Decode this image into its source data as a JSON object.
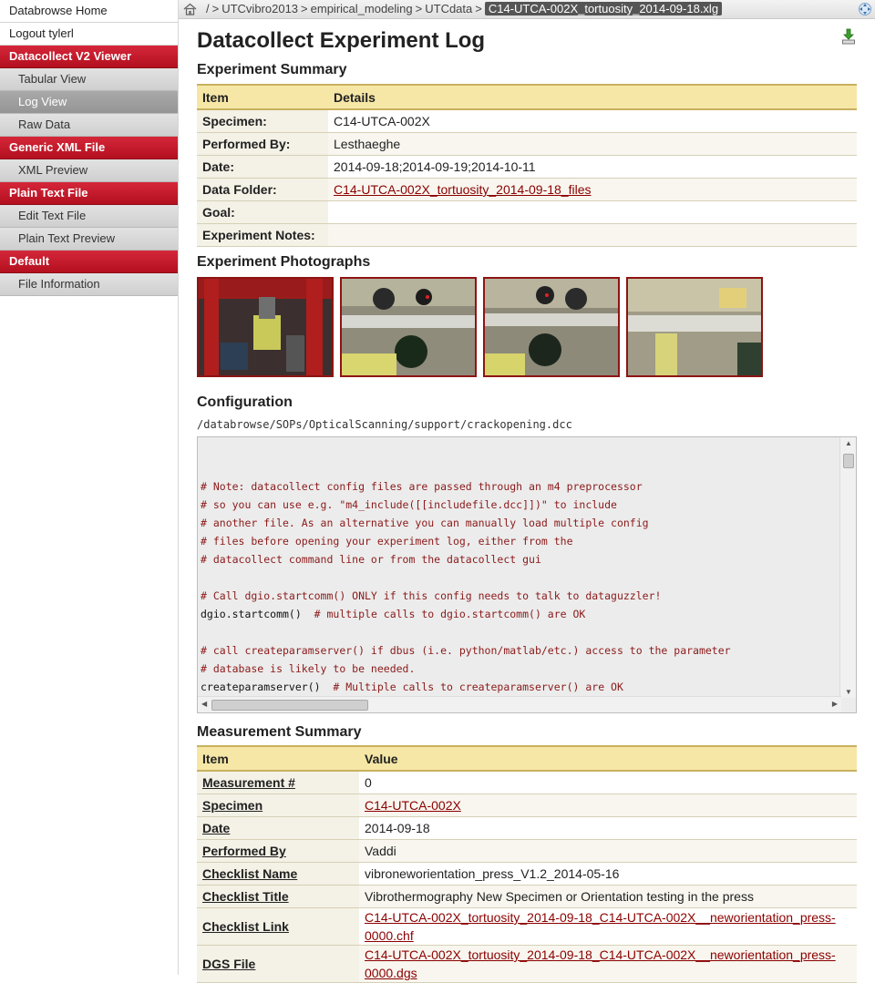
{
  "sidebar": {
    "top_links": [
      "Databrowse Home",
      "Logout tylerl"
    ],
    "sections": [
      {
        "title": "Datacollect V2 Viewer",
        "items": [
          {
            "label": "Tabular View",
            "active": false
          },
          {
            "label": "Log View",
            "active": true
          },
          {
            "label": "Raw Data",
            "active": false
          }
        ]
      },
      {
        "title": "Generic XML File",
        "items": [
          {
            "label": "XML Preview",
            "active": false
          }
        ]
      },
      {
        "title": "Plain Text File",
        "items": [
          {
            "label": "Edit Text File",
            "active": false
          },
          {
            "label": "Plain Text Preview",
            "active": false
          }
        ]
      },
      {
        "title": "Default",
        "items": [
          {
            "label": "File Information",
            "active": false
          }
        ]
      }
    ]
  },
  "breadcrumb": [
    "/",
    ">",
    "UTCvibro2013",
    ">",
    "empirical_modeling",
    ">",
    "UTCdata",
    ">"
  ],
  "breadcrumb_current": "C14-UTCA-002X_tortuosity_2014-09-18.xlg",
  "page_title": "Datacollect Experiment Log",
  "experiment_summary": {
    "heading": "Experiment Summary",
    "col_item": "Item",
    "col_details": "Details",
    "rows": [
      {
        "key": "Specimen:",
        "value": "C14-UTCA-002X",
        "link": false
      },
      {
        "key": "Performed By:",
        "value": "Lesthaeghe",
        "link": false
      },
      {
        "key": "Date:",
        "value": "2014-09-18;2014-09-19;2014-10-11",
        "link": false
      },
      {
        "key": "Data Folder:",
        "value": "C14-UTCA-002X_tortuosity_2014-09-18_files",
        "link": true
      },
      {
        "key": "Goal:",
        "value": "",
        "link": false
      },
      {
        "key": "Experiment Notes:",
        "value": "",
        "link": false
      }
    ]
  },
  "photos_heading": "Experiment Photographs",
  "configuration": {
    "heading": "Configuration",
    "path": "/databrowse/SOPs/OpticalScanning/support/crackopening.dcc",
    "lines": [
      {
        "text": "# Note: datacollect config files are passed through an m4 preprocessor",
        "kind": "c"
      },
      {
        "text": "# so you can use e.g. \"m4_include([[includefile.dcc]])\" to include",
        "kind": "c"
      },
      {
        "text": "# another file. As an alternative you can manually load multiple config",
        "kind": "c"
      },
      {
        "text": "# files before opening your experiment log, either from the",
        "kind": "c"
      },
      {
        "text": "# datacollect command line or from the datacollect gui",
        "kind": "c"
      },
      {
        "text": "",
        "kind": "c"
      },
      {
        "text": "# Call dgio.startcomm() ONLY if this config needs to talk to dataguzzler!",
        "kind": "c"
      },
      {
        "text": "dgio.startcomm()",
        "kind": "p",
        "tail": "  # multiple calls to dgio.startcomm() are OK"
      },
      {
        "text": "",
        "kind": "c"
      },
      {
        "text": "# call createparamserver() if dbus (i.e. python/matlab/etc.) access to the parameter",
        "kind": "c"
      },
      {
        "text": "# database is likely to be needed.",
        "kind": "c"
      },
      {
        "text": "createparamserver()",
        "kind": "p",
        "tail": "  # Multiple calls to createparamserver() are OK"
      }
    ]
  },
  "measurement_summary": {
    "heading": "Measurement Summary",
    "col_item": "Item",
    "col_value": "Value",
    "rows": [
      {
        "key": "Measurement #",
        "value": "0",
        "link": false
      },
      {
        "key": "Specimen",
        "value": "C14-UTCA-002X",
        "link": true
      },
      {
        "key": "Date",
        "value": "2014-09-18",
        "link": false
      },
      {
        "key": "Performed By",
        "value": "Vaddi",
        "link": false
      },
      {
        "key": "Checklist Name",
        "value": "vibroneworientation_press_V1.2_2014-05-16",
        "link": false
      },
      {
        "key": "Checklist Title",
        "value": "Vibrothermography New Specimen or Orientation testing in the press",
        "link": false
      },
      {
        "key": "Checklist Link",
        "value": "C14-UTCA-002X_tortuosity_2014-09-18_C14-UTCA-002X__neworientation_press-0000.chf",
        "link": true
      },
      {
        "key": "DGS File",
        "value": "C14-UTCA-002X_tortuosity_2014-09-18_C14-UTCA-002X__neworientation_press-0000.dgs",
        "link": true
      }
    ]
  }
}
